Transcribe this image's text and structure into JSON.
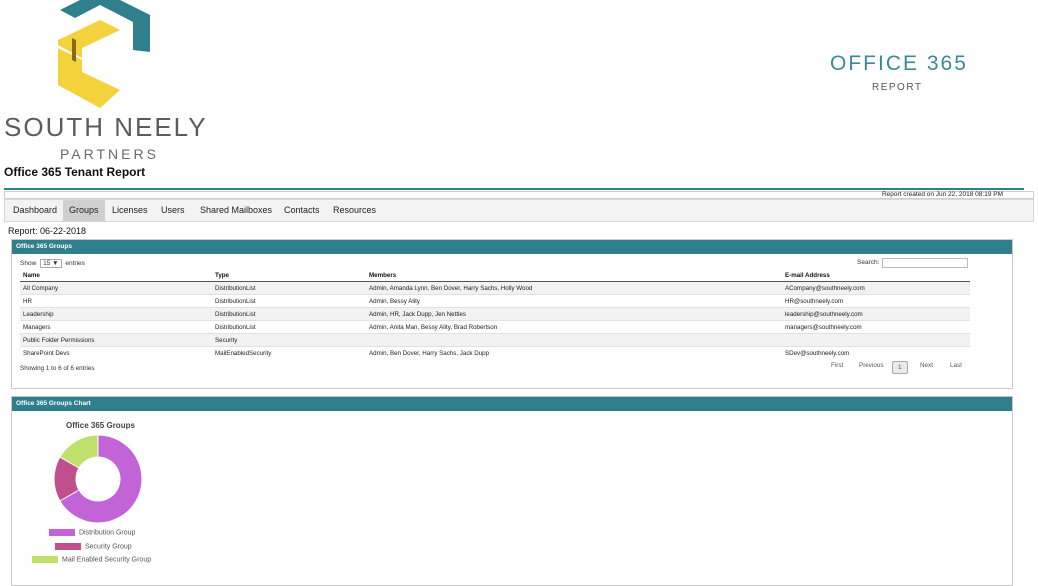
{
  "brand": {
    "name": "SOUTH NEELY",
    "sub": "PARTNERS"
  },
  "report": {
    "title": "Office 365 Tenant Report",
    "product": "OFFICE 365",
    "product_sub": "REPORT",
    "created": "Report created on Jun 22, 2018 08:19 PM",
    "date": "Report: 06-22-2018"
  },
  "tabs": [
    "Dashboard",
    "Groups",
    "Licenses",
    "Users",
    "Shared Mailboxes",
    "Contacts",
    "Resources"
  ],
  "active_tab": "Groups",
  "groups_panel": {
    "title": "Office 365 Groups",
    "show_prefix": "Show",
    "show_value": "15",
    "show_suffix": "entries",
    "search_label": "Search:",
    "search_value": "",
    "columns": [
      "Name",
      "Type",
      "Members",
      "E-mail Address"
    ],
    "rows": [
      [
        "All Company",
        "DistributionList",
        "Admin, Amanda Lynn, Ben Dover, Harry Sachs, Holly Wood",
        "ACompany@southneely.com"
      ],
      [
        "HR",
        "DistributionList",
        "Admin, Bessy Ality",
        "HR@southneely.com"
      ],
      [
        "Leadership",
        "DistributionList",
        "Admin, HR, Jack Dupp, Jen Nettles",
        "leadership@southneely.com"
      ],
      [
        "Managers",
        "DistributionList",
        "Admin, Anita Man, Bessy Ality, Brad Robertson",
        "managers@southneely.com"
      ],
      [
        "Public Folder Permissions",
        "Security",
        "",
        ""
      ],
      [
        "SharePoint Devs",
        "MailEnabledSecurity",
        "Admin, Ben Dover, Harry Sachs, Jack Dupp",
        "SDev@southneely.com"
      ]
    ],
    "showing": "Showing 1 to 6 of 6 entries",
    "pager": {
      "first": "First",
      "previous": "Previous",
      "current": "1",
      "next": "Next",
      "last": "Last"
    }
  },
  "chart_panel": {
    "title": "Office 365 Groups Chart"
  },
  "chart_data": {
    "type": "pie",
    "title": "Office 365 Groups",
    "categories": [
      "Distribution Group",
      "Security Group",
      "Mail Enabled Security Group"
    ],
    "values": [
      4,
      1,
      1
    ],
    "colors": [
      "#c264d8",
      "#c0508c",
      "#bfe06a"
    ],
    "donut": true,
    "legend_position": "bottom"
  },
  "colors": {
    "accent": "#2f7f8c",
    "logo_teal": "#2f7f8c",
    "logo_yellow": "#f4d23b"
  }
}
